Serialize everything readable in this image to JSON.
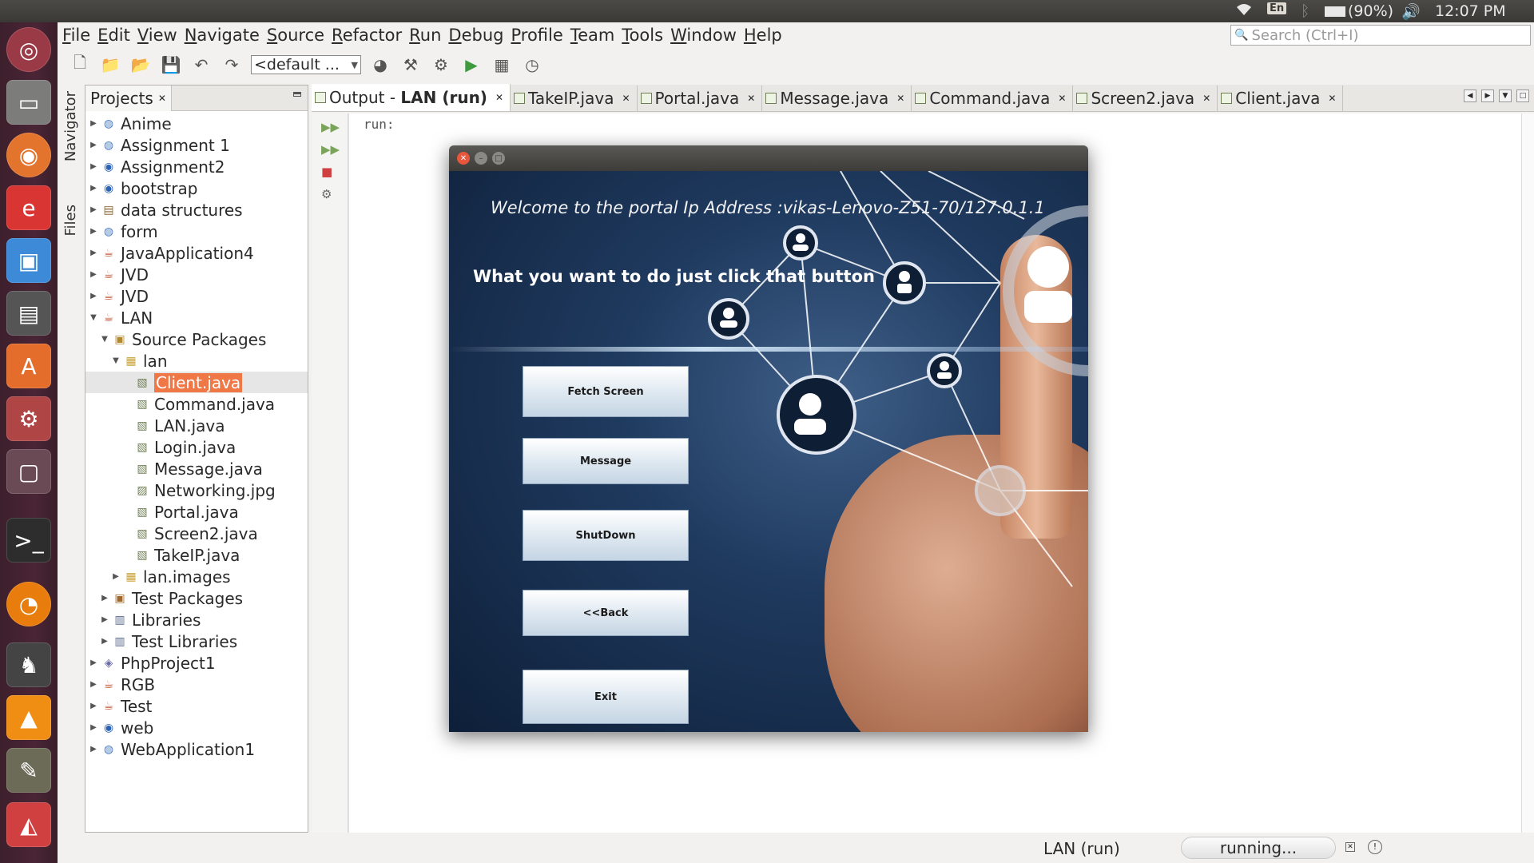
{
  "top_panel": {
    "keyboard_layout": "En",
    "battery": "(90%)",
    "clock": "12:07 PM"
  },
  "menubar": {
    "items": [
      "File",
      "Edit",
      "View",
      "Navigate",
      "Source",
      "Refactor",
      "Run",
      "Debug",
      "Profile",
      "Team",
      "Tools",
      "Window",
      "Help"
    ],
    "search_placeholder": "Search (Ctrl+I)"
  },
  "toolbar": {
    "config_value": "<default ..."
  },
  "side_tabs": {
    "navigator": "Navigator",
    "files": "Files"
  },
  "projects": {
    "tab_label": "Projects",
    "tree": [
      {
        "label": "Anime",
        "level": 0,
        "expanded": false,
        "icon": "web-project-icon"
      },
      {
        "label": "Assignment 1",
        "level": 0,
        "expanded": false,
        "icon": "web-project-icon"
      },
      {
        "label": "Assignment2",
        "level": 0,
        "expanded": false,
        "icon": "globe-project-icon"
      },
      {
        "label": "bootstrap",
        "level": 0,
        "expanded": false,
        "icon": "globe-project-icon"
      },
      {
        "label": "data structures",
        "level": 0,
        "expanded": false,
        "icon": "module-icon"
      },
      {
        "label": "form",
        "level": 0,
        "expanded": false,
        "icon": "web-project-icon"
      },
      {
        "label": "JavaApplication4",
        "level": 0,
        "expanded": false,
        "icon": "java-cup-icon"
      },
      {
        "label": "JVD",
        "level": 0,
        "expanded": false,
        "icon": "java-cup-icon"
      },
      {
        "label": "JVD",
        "level": 0,
        "expanded": false,
        "icon": "java-cup-icon"
      },
      {
        "label": "LAN",
        "level": 0,
        "expanded": true,
        "icon": "java-cup-icon"
      },
      {
        "label": "Source Packages",
        "level": 1,
        "expanded": true,
        "icon": "source-packages-icon"
      },
      {
        "label": "lan",
        "level": 2,
        "expanded": true,
        "icon": "package-icon"
      },
      {
        "label": "Client.java",
        "level": 3,
        "selected": true,
        "icon": "java-file-icon"
      },
      {
        "label": "Command.java",
        "level": 3,
        "icon": "java-file-icon"
      },
      {
        "label": "LAN.java",
        "level": 3,
        "icon": "java-file-icon"
      },
      {
        "label": "Login.java",
        "level": 3,
        "icon": "java-file-icon"
      },
      {
        "label": "Message.java",
        "level": 3,
        "icon": "java-file-icon"
      },
      {
        "label": "Networking.jpg",
        "level": 3,
        "icon": "image-file-icon"
      },
      {
        "label": "Portal.java",
        "level": 3,
        "icon": "java-file-icon"
      },
      {
        "label": "Screen2.java",
        "level": 3,
        "icon": "java-file-icon"
      },
      {
        "label": "TakeIP.java",
        "level": 3,
        "icon": "java-file-icon"
      },
      {
        "label": "lan.images",
        "level": 2,
        "expanded": false,
        "icon": "package-icon"
      },
      {
        "label": "Test Packages",
        "level": 1,
        "expanded": false,
        "icon": "test-packages-icon"
      },
      {
        "label": "Libraries",
        "level": 1,
        "expanded": false,
        "icon": "libraries-icon"
      },
      {
        "label": "Test Libraries",
        "level": 1,
        "expanded": false,
        "icon": "libraries-icon"
      },
      {
        "label": "PhpProject1",
        "level": 0,
        "expanded": false,
        "icon": "php-icon"
      },
      {
        "label": "RGB",
        "level": 0,
        "expanded": false,
        "icon": "java-cup-icon"
      },
      {
        "label": "Test",
        "level": 0,
        "expanded": false,
        "icon": "java-cup-icon"
      },
      {
        "label": "web",
        "level": 0,
        "expanded": false,
        "icon": "globe-project-icon"
      },
      {
        "label": "WebApplication1",
        "level": 0,
        "expanded": false,
        "icon": "web-project-icon"
      }
    ]
  },
  "editor": {
    "tabs": [
      {
        "label_prefix": "Output - ",
        "label_bold": "LAN (run)",
        "active": true
      },
      {
        "label": "TakeIP.java"
      },
      {
        "label": "Portal.java"
      },
      {
        "label": "Message.java"
      },
      {
        "label": "Command.java"
      },
      {
        "label": "Screen2.java"
      },
      {
        "label": "Client.java"
      }
    ],
    "output_text": "run:"
  },
  "status_bar": {
    "run_label": "LAN (run)",
    "progress_text": "running..."
  },
  "app_window": {
    "welcome_text": "Welcome to the portal Ip Address :vikas-Lenovo-Z51-70/127.0.1.1",
    "action_text": "What you want to do just click that button",
    "buttons": [
      "Fetch Screen",
      "Message",
      "ShutDown",
      "<<Back",
      "Exit"
    ]
  },
  "colors": {
    "selection": "#f07746",
    "launcher_bg": "#4a2535",
    "panel_bg": "#3a3935"
  }
}
